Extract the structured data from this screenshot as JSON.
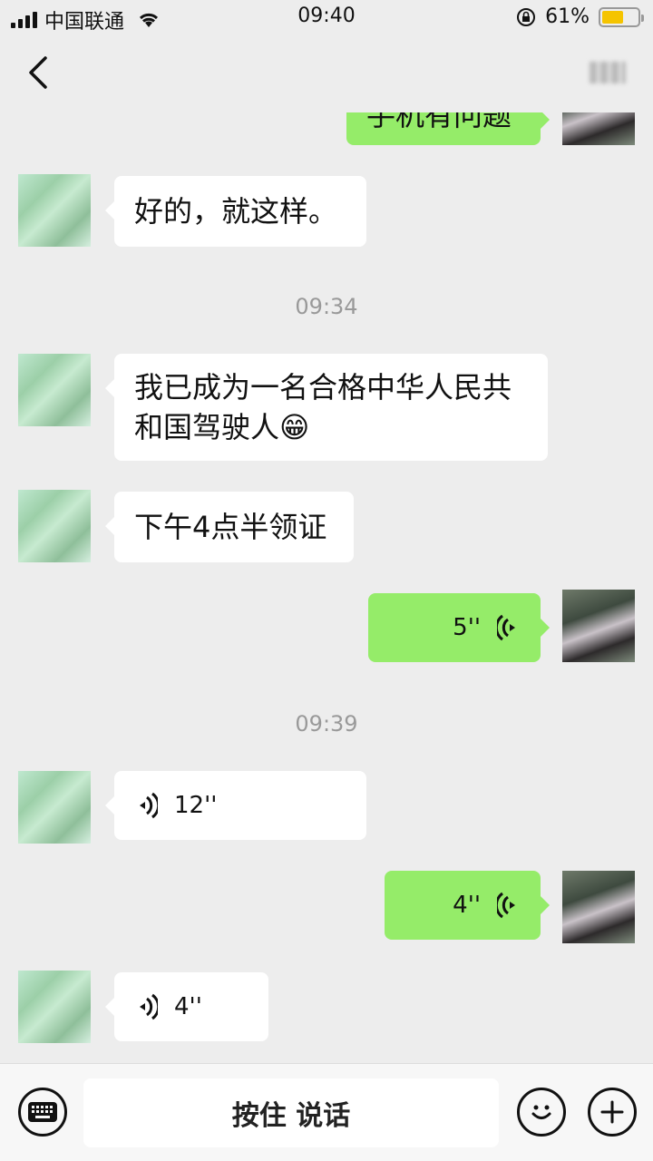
{
  "status_bar": {
    "carrier": "中国联通",
    "time": "09:40",
    "battery_percent": "61%",
    "battery_level": 0.61,
    "accent_battery": "#f5c400"
  },
  "nav": {
    "title": "",
    "back_icon": "chevron-left-icon",
    "more_icon": "more-icon"
  },
  "messages": [
    {
      "type": "text",
      "side": "out",
      "text": "手机有问题"
    },
    {
      "type": "text",
      "side": "in",
      "text": "好的，就这样。"
    },
    {
      "type": "time",
      "text": "09:34"
    },
    {
      "type": "text",
      "side": "in",
      "line1": "我已成为一名合格中华人民共",
      "line2": "和国驾驶人😁"
    },
    {
      "type": "text",
      "side": "in",
      "text": "下午4点半领证"
    },
    {
      "type": "voice",
      "side": "out",
      "duration": "5''"
    },
    {
      "type": "time",
      "text": "09:39"
    },
    {
      "type": "voice",
      "side": "in",
      "duration": "12''"
    },
    {
      "type": "voice",
      "side": "out",
      "duration": "4''"
    },
    {
      "type": "voice",
      "side": "in",
      "duration": "4''"
    }
  ],
  "input_bar": {
    "talk_label": "按住 说话",
    "keyboard_icon": "keyboard-icon",
    "emoji_icon": "emoji-icon",
    "plus_icon": "plus-icon"
  },
  "colors": {
    "background": "#ededed",
    "incoming_bubble": "#ffffff",
    "outgoing_bubble": "#95ec69",
    "timestamp": "#999999"
  }
}
